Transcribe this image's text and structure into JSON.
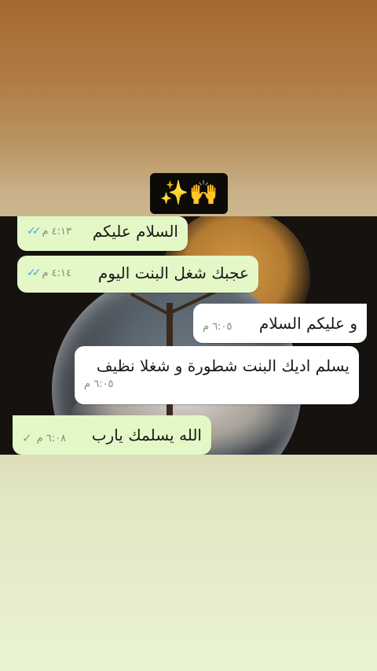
{
  "header": {
    "emoji_badge": "✨🙌"
  },
  "messages": [
    {
      "text": "السلام عليكم",
      "time": "٤:١٣ م",
      "status": "✓✓"
    },
    {
      "text": "عجبك شغل البنت اليوم",
      "time": "٤:١٤ م",
      "status": "✓✓"
    },
    {
      "text": "و عليكم السلام",
      "time": "٦:٠٥ م"
    },
    {
      "text": "يسلم اديك البنت شطورة و شغلا نظيف",
      "time": "٦:٠٥ م"
    },
    {
      "text": "الله يسلمك يارب",
      "time": "٦:٠٨ م",
      "status": "✓"
    }
  ],
  "colors": {
    "outgoing_bubble": "#e3f8c6",
    "incoming_bubble": "#ffffff",
    "read_ticks": "#4aa3e4"
  }
}
